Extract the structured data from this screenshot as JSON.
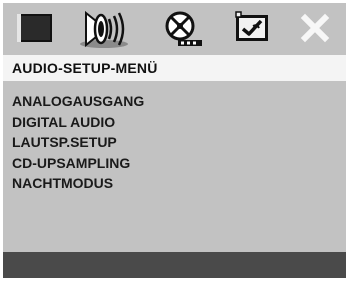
{
  "tabs": [
    {
      "icon": "general-setup-icon"
    },
    {
      "icon": "audio-setup-icon"
    },
    {
      "icon": "video-setup-icon"
    },
    {
      "icon": "preference-setup-icon"
    },
    {
      "icon": "close-icon"
    }
  ],
  "menu": {
    "title": "AUDIO-SETUP-MENÜ",
    "items": [
      "ANALOGAUSGANG",
      "DIGITAL AUDIO",
      "LAUTSP.SETUP",
      "CD-UPSAMPLING",
      "NACHTMODUS"
    ]
  },
  "colors": {
    "background": "#c2c2c2",
    "title_strip": "#f4f4f4",
    "footer": "#4a4a4a",
    "active_tab": "#7a7a7a",
    "icon_dark": "#111111"
  }
}
